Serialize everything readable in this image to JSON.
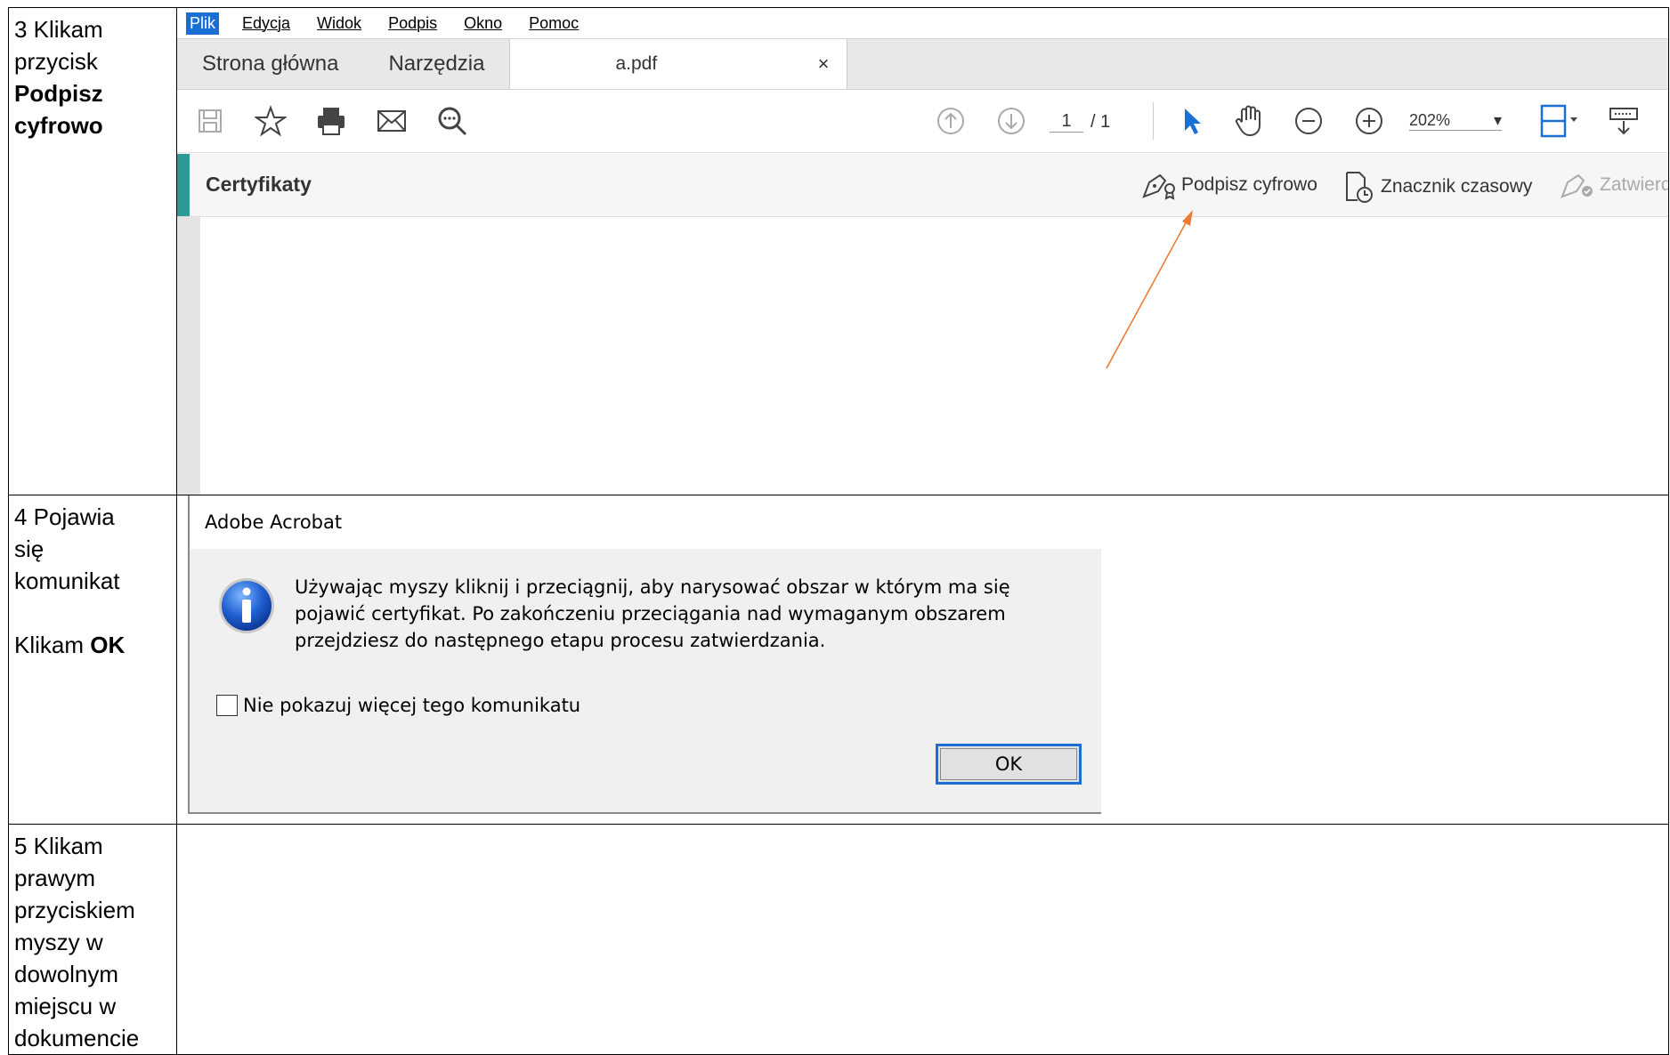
{
  "steps": [
    {
      "line1": "3 Klikam",
      "line2": "przycisk",
      "bold": "Podpisz cyfrowo"
    },
    {
      "line1": "4 Pojawia",
      "line2": "się",
      "line3": "komunikat",
      "action_prefix": "Klikam ",
      "action_bold": "OK"
    },
    {
      "text": "5 Klikam prawym przyciskiem myszy w dowolnym miejscu w dokumencie"
    }
  ],
  "acrobat": {
    "menu": [
      "Plik",
      "Edycja",
      "Widok",
      "Podpis",
      "Okno",
      "Pomoc"
    ],
    "active_menu": "Plik",
    "tabs": {
      "home": "Strona główna",
      "tools": "Narzędzia",
      "document": "a.pdf",
      "close": "×"
    },
    "page": {
      "current": "1",
      "total": "/ 1"
    },
    "zoom": "202%",
    "cert_panel": {
      "title": "Certyfikaty",
      "actions": [
        "Podpisz cyfrowo",
        "Znacznik czasowy",
        "Zatwierd:"
      ]
    },
    "accent_color": "#2b9a95",
    "arrow_color": "#ed7d31"
  },
  "dialog": {
    "title": "Adobe Acrobat",
    "message": "Używając myszy kliknij i przeciągnij, aby narysować obszar w którym ma się pojawić certyfikat. Po zakończeniu przeciągania nad wymaganym obszarem przejdziesz do następnego etapu procesu zatwierdzania.",
    "checkbox_label": "Nie pokazuj więcej tego komunikatu",
    "ok_label": "OK"
  }
}
